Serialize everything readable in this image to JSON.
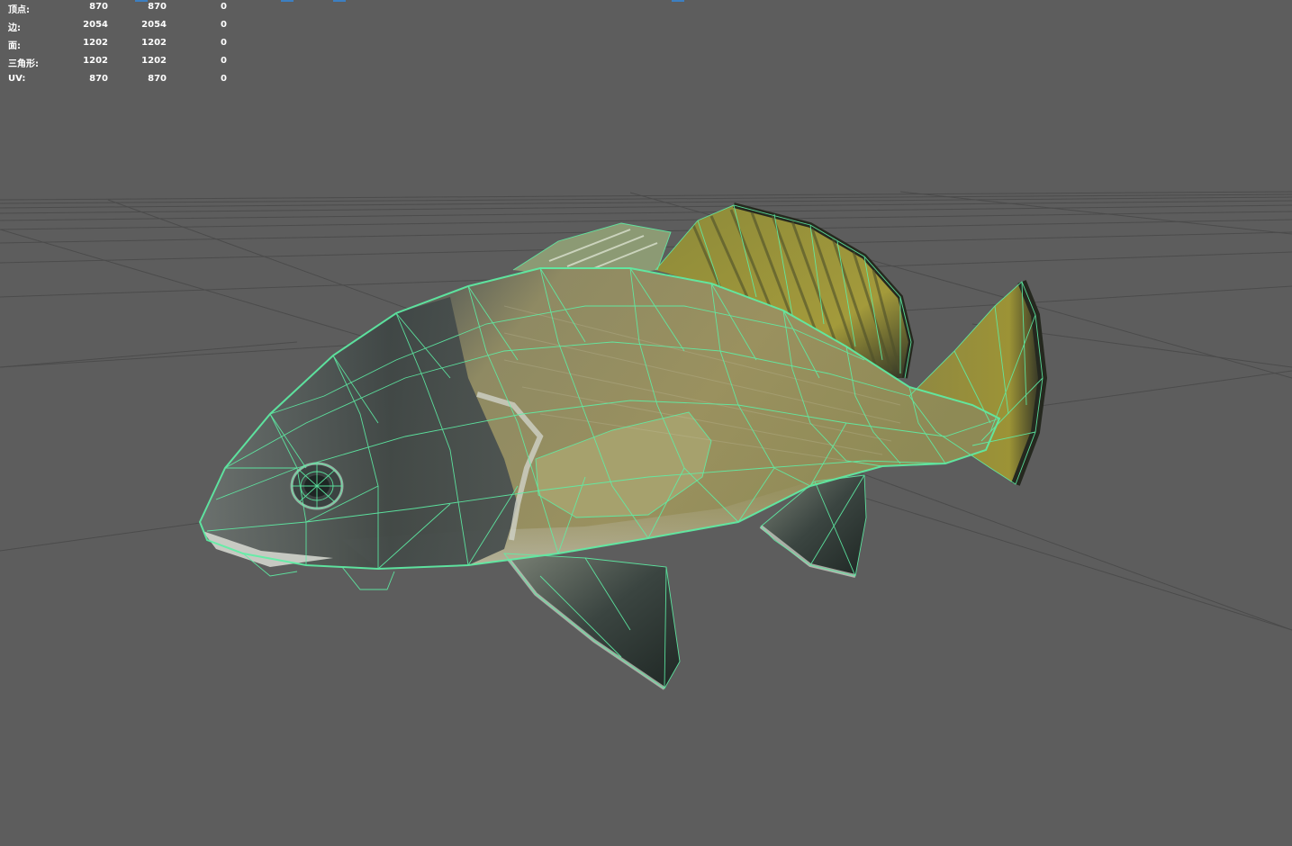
{
  "viewport": {
    "background": "#5d5d5d",
    "grid_color": "#474747",
    "wire_color": "#5ef0a6"
  },
  "hud": {
    "rows": [
      {
        "label": "顶点:",
        "v1": "870",
        "v2": "870",
        "v3": "0"
      },
      {
        "label": "边:",
        "v1": "2054",
        "v2": "2054",
        "v3": "0"
      },
      {
        "label": "面:",
        "v1": "1202",
        "v2": "1202",
        "v3": "0"
      },
      {
        "label": "三角形:",
        "v1": "1202",
        "v2": "1202",
        "v3": "0"
      },
      {
        "label": "UV:",
        "v1": "870",
        "v2": "870",
        "v3": "0"
      }
    ]
  },
  "model": {
    "icon": "fish-mesh-wireframe"
  }
}
